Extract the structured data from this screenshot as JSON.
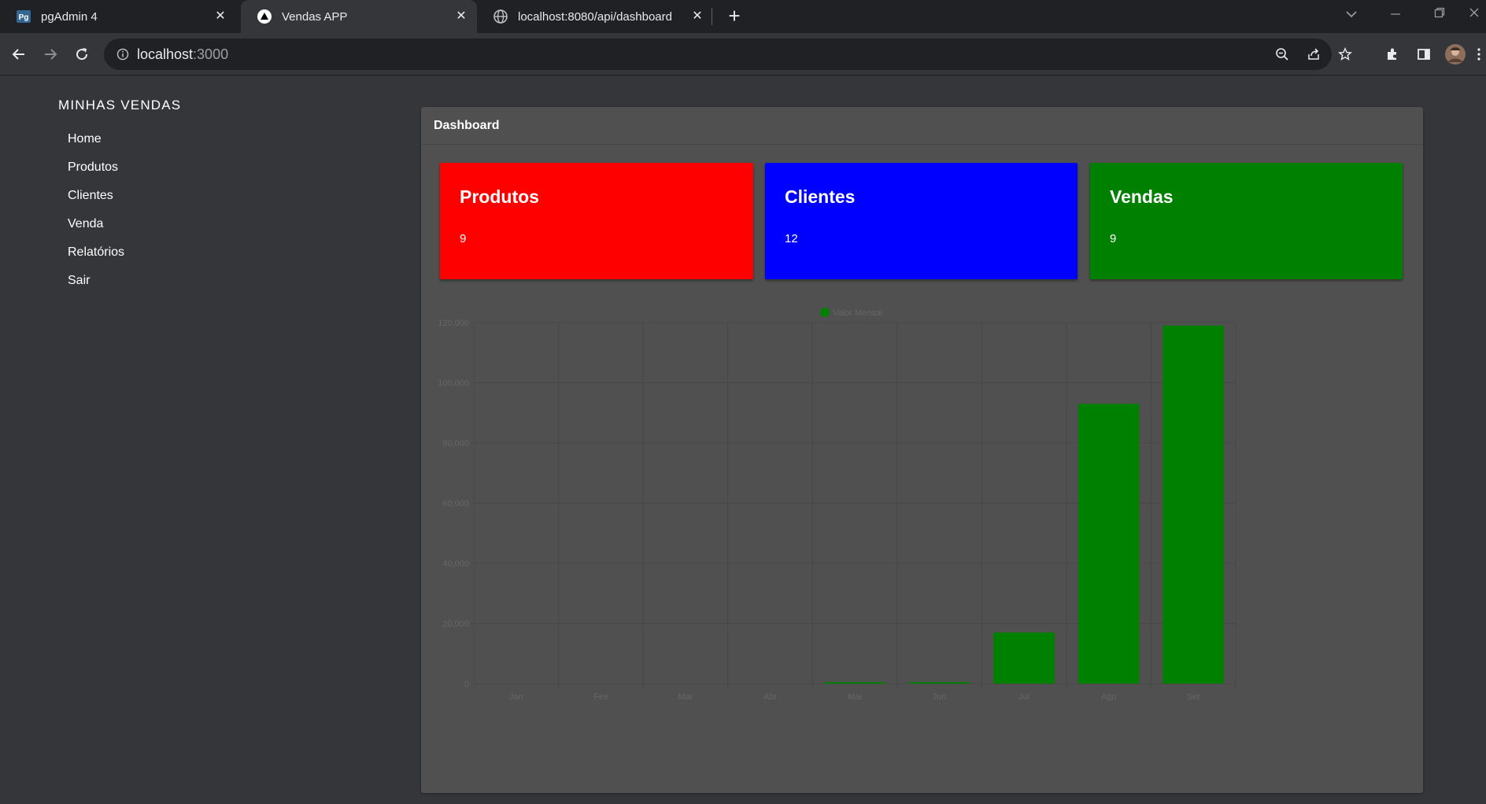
{
  "browser": {
    "tabs": [
      {
        "title": "pgAdmin 4",
        "favicon": "pgadmin-icon",
        "active": false
      },
      {
        "title": "Vendas APP",
        "favicon": "nextjs-icon",
        "active": true
      },
      {
        "title": "localhost:8080/api/dashboard",
        "favicon": "globe-icon",
        "active": false
      }
    ],
    "address": {
      "host": "localhost",
      "port": ":3000"
    }
  },
  "sidebar": {
    "brand": "MINHAS VENDAS",
    "items": [
      {
        "label": "Home"
      },
      {
        "label": "Produtos"
      },
      {
        "label": "Clientes"
      },
      {
        "label": "Venda"
      },
      {
        "label": "Relatórios"
      },
      {
        "label": "Sair"
      }
    ]
  },
  "dashboard": {
    "title": "Dashboard",
    "cards": [
      {
        "title": "Produtos",
        "value": "9",
        "color": "#ff0000"
      },
      {
        "title": "Clientes",
        "value": "12",
        "color": "#0000ff"
      },
      {
        "title": "Vendas",
        "value": "9",
        "color": "#008000"
      }
    ]
  },
  "chart_data": {
    "type": "bar",
    "categories": [
      "Jan",
      "Fev",
      "Mar",
      "Abr",
      "Mai",
      "Jun",
      "Jul",
      "Ago",
      "Set"
    ],
    "series": [
      {
        "name": "Valor Mensal",
        "color": "#008000",
        "values": [
          0,
          0,
          0,
          0,
          500,
          500,
          17000,
          93000,
          119000
        ]
      }
    ],
    "yticks": [
      "0",
      "20,000",
      "40,000",
      "60,000",
      "80,000",
      "100,000",
      "120,000"
    ],
    "ylim": [
      0,
      120000
    ],
    "grid": true,
    "legend": "top-center"
  }
}
